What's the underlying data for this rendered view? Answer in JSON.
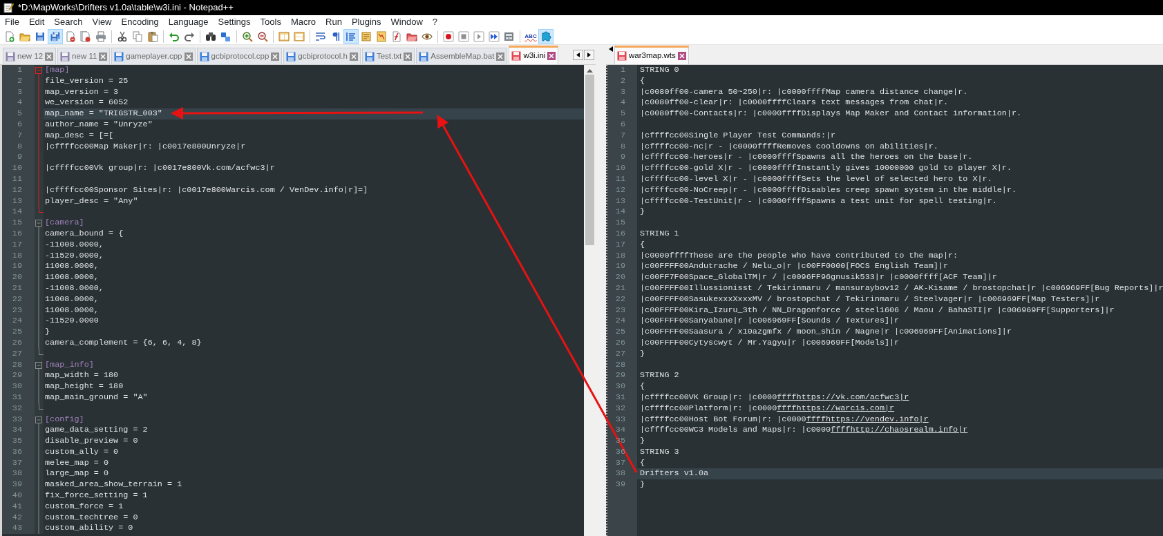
{
  "window": {
    "title": "*D:\\MapWorks\\Drifters v1.0a\\table\\w3i.ini - Notepad++"
  },
  "menu": [
    "File",
    "Edit",
    "Search",
    "View",
    "Encoding",
    "Language",
    "Settings",
    "Tools",
    "Macro",
    "Run",
    "Plugins",
    "Window",
    "?"
  ],
  "toolbar": [
    [
      {
        "pressed": false
      },
      {
        "pressed": false
      },
      {
        "pressed": false
      },
      {
        "pressed": true
      },
      {
        "pressed": false
      },
      {
        "pressed": false
      },
      {
        "pressed": false
      }
    ],
    [
      {
        "pressed": false
      },
      {
        "pressed": false
      },
      {
        "pressed": false
      }
    ],
    [
      {
        "pressed": false
      },
      {
        "pressed": false
      }
    ],
    [
      {
        "pressed": false
      },
      {
        "pressed": false
      }
    ],
    [
      {
        "pressed": false
      },
      {
        "pressed": false
      }
    ],
    [
      {
        "pressed": false
      },
      {
        "pressed": false
      }
    ],
    [
      {
        "pressed": false
      },
      {
        "pressed": false
      },
      {
        "pressed": true
      },
      {
        "pressed": false
      },
      {
        "pressed": false
      },
      {
        "pressed": false
      },
      {
        "pressed": false
      },
      {
        "pressed": false
      }
    ],
    [
      {
        "pressed": false
      },
      {
        "pressed": false
      },
      {
        "pressed": false
      },
      {
        "pressed": false
      },
      {
        "pressed": false
      }
    ],
    [
      {
        "pressed": false,
        "label": "ABC"
      },
      {
        "pressed": true
      }
    ]
  ],
  "left_tabs": [
    {
      "label": "new 12",
      "kind": "new",
      "selected": false
    },
    {
      "label": "new 11",
      "kind": "new",
      "selected": false
    },
    {
      "label": "gameplayer.cpp",
      "kind": "saved",
      "selected": false
    },
    {
      "label": "gcbiprotocol.cpp",
      "kind": "saved",
      "selected": false
    },
    {
      "label": "gcbiprotocol.h",
      "kind": "saved",
      "selected": false
    },
    {
      "label": "Test.txt",
      "kind": "saved",
      "selected": false
    },
    {
      "label": "AssembleMap.bat",
      "kind": "saved",
      "selected": false
    },
    {
      "label": "w3i.ini",
      "kind": "modified",
      "selected": true
    }
  ],
  "right_tabs": [
    {
      "label": "war3map.wts",
      "kind": "modified",
      "selected": true
    }
  ],
  "left_editor": {
    "sections": [
      {
        "number": "1",
        "header": "[map]",
        "highlighted": true,
        "current": false,
        "ends": true,
        "lines": [
          {
            "number": "2",
            "text": "file_version = 25",
            "current": false
          },
          {
            "number": "3",
            "text": "map_version = 3",
            "current": false
          },
          {
            "number": "4",
            "text": "we_version = 6052",
            "current": false
          },
          {
            "number": "5",
            "text": "map_name = \"TRIGSTR_003\"",
            "current": true
          },
          {
            "number": "6",
            "text": "author_name = \"Unryze\"",
            "current": false
          },
          {
            "number": "7",
            "text": "map_desc = [=[",
            "current": false
          },
          {
            "number": "8",
            "text": "|cffffcc00Map Maker|r: |c0017e800Unryze|r",
            "current": false
          },
          {
            "number": "9",
            "current": false
          },
          {
            "number": "10",
            "text": "|cffffcc00Vk group|r: |c0017e800Vk.com/acfwc3|r",
            "current": false
          },
          {
            "number": "11",
            "current": false
          },
          {
            "number": "12",
            "text": "|cffffcc00Sponsor Sites|r: |c0017e800Warcis.com / VenDev.info|r]=]",
            "current": false
          },
          {
            "number": "13",
            "text": "player_desc = \"Any\"",
            "current": false
          },
          {
            "number": "14",
            "current": false
          }
        ]
      },
      {
        "number": "15",
        "header": "[camera]",
        "highlighted": false,
        "current": false,
        "ends": true,
        "lines": [
          {
            "number": "16",
            "text": "camera_bound = {",
            "current": false
          },
          {
            "number": "17",
            "text": "-11008.0000,",
            "current": false
          },
          {
            "number": "18",
            "text": "-11520.0000,",
            "current": false
          },
          {
            "number": "19",
            "text": "11008.0000,",
            "current": false
          },
          {
            "number": "20",
            "text": "11008.0000,",
            "current": false
          },
          {
            "number": "21",
            "text": "-11008.0000,",
            "current": false
          },
          {
            "number": "22",
            "text": "11008.0000,",
            "current": false
          },
          {
            "number": "23",
            "text": "11008.0000,",
            "current": false
          },
          {
            "number": "24",
            "text": "-11520.0000",
            "current": false
          },
          {
            "number": "25",
            "text": "}",
            "current": false
          },
          {
            "number": "26",
            "text": "camera_complement = {6, 6, 4, 8}",
            "current": false
          },
          {
            "number": "27",
            "current": false
          }
        ]
      },
      {
        "number": "28",
        "header": "[map_info]",
        "highlighted": false,
        "current": false,
        "ends": true,
        "lines": [
          {
            "number": "29",
            "text": "map_width = 180",
            "current": false
          },
          {
            "number": "30",
            "text": "map_height = 180",
            "current": false
          },
          {
            "number": "31",
            "text": "map_main_ground = \"A\"",
            "current": false
          },
          {
            "number": "32",
            "current": false
          }
        ]
      },
      {
        "number": "33",
        "header": "[config]",
        "highlighted": false,
        "current": false,
        "ends": false,
        "lines": [
          {
            "number": "34",
            "text": "game_data_setting = 2",
            "current": false
          },
          {
            "number": "35",
            "text": "disable_preview = 0",
            "current": false
          },
          {
            "number": "36",
            "text": "custom_ally = 0",
            "current": false
          },
          {
            "number": "37",
            "text": "melee_map = 0",
            "current": false
          },
          {
            "number": "38",
            "text": "large_map = 0",
            "current": false
          },
          {
            "number": "39",
            "text": "masked_area_show_terrain = 1",
            "current": false
          },
          {
            "number": "40",
            "text": "fix_force_setting = 1",
            "current": false
          },
          {
            "number": "41",
            "text": "custom_force = 1",
            "current": false
          },
          {
            "number": "42",
            "text": "custom_techtree = 0",
            "current": false
          },
          {
            "number": "43",
            "text": "custom_ability = 0",
            "current": false
          }
        ]
      }
    ]
  },
  "right_editor": {
    "lines": [
      {
        "number": "1",
        "text": "STRING 0",
        "current": false
      },
      {
        "number": "2",
        "text": "{",
        "current": false
      },
      {
        "number": "3",
        "text": "|c0080ff00-camera 50~250|r: |c0000ffffMap camera distance change|r.",
        "current": false
      },
      {
        "number": "4",
        "text": "|c0080ff00-clear|r: |c0000ffffClears text messages from chat|r.",
        "current": false
      },
      {
        "number": "5",
        "text": "|c0080ff00-Contacts|r: |c0000ffffDisplays Map Maker and Contact information|r.",
        "current": false
      },
      {
        "number": "6",
        "current": false
      },
      {
        "number": "7",
        "text": "|cffffcc00Single Player Test Commands:|r",
        "current": false
      },
      {
        "number": "8",
        "text": "|cffffcc00-nc|r - |c0000ffffRemoves cooldowns on abilities|r.",
        "current": false
      },
      {
        "number": "9",
        "text": "|cffffcc00-heroes|r - |c0000ffffSpawns all the heroes on the base|r.",
        "current": false
      },
      {
        "number": "10",
        "text": "|cffffcc00-gold X|r - |c0000ffffInstantly gives 10000000 gold to player X|r.",
        "current": false
      },
      {
        "number": "11",
        "text": "|cffffcc00-level X|r - |c0000ffffSets the level of selected hero to X|r.",
        "current": false
      },
      {
        "number": "12",
        "text": "|cffffcc00-NoCreep|r - |c0000ffffDisables creep spawn system in the middle|r.",
        "current": false
      },
      {
        "number": "13",
        "text": "|cffffcc00-TestUnit|r - |c0000ffffSpawns a test unit for spell testing|r.",
        "current": false
      },
      {
        "number": "14",
        "text": "}",
        "current": false
      },
      {
        "number": "15",
        "current": false
      },
      {
        "number": "16",
        "text": "STRING 1",
        "current": false
      },
      {
        "number": "17",
        "text": "{",
        "current": false
      },
      {
        "number": "18",
        "text": "|c0000ffffThese are the people who have contributed to the map|r:",
        "current": false
      },
      {
        "number": "19",
        "text": "|c00FFFF00Andutrache / Nelu_o|r |c00FF0000[FOCS English Team]|r",
        "current": false
      },
      {
        "number": "20",
        "text": "|c00FF7F00Space_GlobalTM|r / |c0096FF96gnusik533|r |c0000ffff[ACF Team]|r",
        "current": false
      },
      {
        "number": "21",
        "text": "|c00FFFF00Illussionisst / Tekirinmaru / mansuraybov12 / AK-Kisame / brostopchat|r |c006969FF[Bug Reports]|r",
        "current": false
      },
      {
        "number": "22",
        "text": "|c00FFFF00SasukexxxXxxxMV / brostopchat / Tekirinmaru / Steelvager|r |c006969FF[Map Testers]|r",
        "current": false
      },
      {
        "number": "23",
        "text": "|c00FFFF00Kira_Izuru_3th / NN_Dragonforce / steel1606 / Maou / BahaSTI|r |c006969FF[Supporters]|r",
        "current": false
      },
      {
        "number": "24",
        "text": "|c00FFFF00Sanyabane|r |c006969FF[Sounds / Textures]|r",
        "current": false
      },
      {
        "number": "25",
        "text": "|c00FFFF00Saasura / x10azgmfx / moon_shin / Nagne|r |c006969FF[Animations]|r",
        "current": false
      },
      {
        "number": "26",
        "text": "|c00FFFF00Cytyscwyt / Mr.Yagyu|r |c006969FF[Models]|r",
        "current": false
      },
      {
        "number": "27",
        "text": "}",
        "current": false
      },
      {
        "number": "28",
        "current": false
      },
      {
        "number": "29",
        "text": "STRING 2",
        "current": false
      },
      {
        "number": "30",
        "text": "{",
        "current": false
      },
      {
        "number": "31",
        "text": "|cffffcc00VK Group|r: |c0000",
        "link": "ffffhttps://vk.com/acfwc3|r",
        "current": false
      },
      {
        "number": "32",
        "text": "|cffffcc00Platform|r: |c0000",
        "link": "ffffhttps://warcis.com|r",
        "current": false
      },
      {
        "number": "33",
        "text": "|cffffcc00Host Bot Forum|r: |c0000",
        "link": "ffffhttps://vendev.info|r",
        "current": false
      },
      {
        "number": "34",
        "text": "|cffffcc00WC3 Models and Maps|r: |c0000",
        "link": "ffffhttp://chaosrealm.info|r",
        "current": false
      },
      {
        "number": "35",
        "text": "}",
        "current": false
      },
      {
        "number": "36",
        "text": "STRING 3",
        "current": false
      },
      {
        "number": "37",
        "text": "{",
        "current": false
      },
      {
        "number": "38",
        "text": "Drifters v1.0a",
        "current": true
      },
      {
        "number": "39",
        "text": "}",
        "current": false
      }
    ]
  }
}
